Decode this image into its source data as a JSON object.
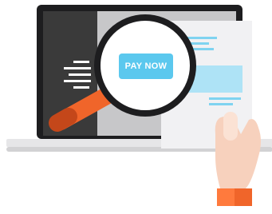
{
  "illustration": {
    "pay_button_label": "PAY NOW",
    "colors": {
      "laptop_frame": "#1d1d1f",
      "screen_left": "#3a3a3a",
      "screen_right": "#cfcfd1",
      "accent_orange": "#f0652a",
      "accent_blue": "#5bc8ee",
      "invoice_paper": "#f1f1f3",
      "skin": "#f7d1bd"
    },
    "icons": [
      "laptop-icon",
      "magnifying-glass-icon",
      "invoice-icon",
      "hand-icon"
    ]
  }
}
